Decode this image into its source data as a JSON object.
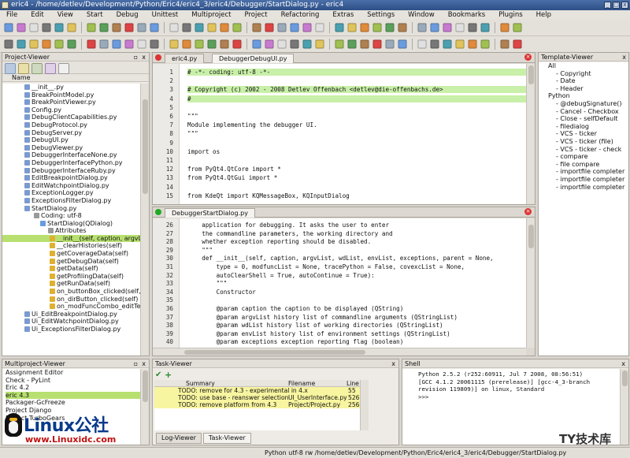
{
  "window": {
    "title": "eric4 - /home/detlev/Development/Python/Eric4/eric4_3/eric4/Debugger/StartDialog.py - eric4"
  },
  "menu": [
    "File",
    "Edit",
    "View",
    "Start",
    "Debug",
    "Unittest",
    "Multiproject",
    "Project",
    "Refactoring",
    "Extras",
    "Settings",
    "Window",
    "Bookmarks",
    "Plugins",
    "Help"
  ],
  "project_viewer": {
    "title": "Project-Viewer",
    "header": "Name",
    "items": [
      "__init__.py",
      "BreakPointModel.py",
      "BreakPointViewer.py",
      "Config.py",
      "DebugClientCapabilities.py",
      "DebugProtocol.py",
      "DebugServer.py",
      "DebugUI.py",
      "DebugViewer.py",
      "DebuggerInterfaceNone.py",
      "DebuggerInterfacePython.py",
      "DebuggerInterfaceRuby.py",
      "EditBreakpointDialog.py",
      "EditWatchpointDialog.py",
      "ExceptionLogger.py",
      "ExceptionsFilterDialog.py",
      "StartDialog.py",
      "Coding: utf-8",
      "StartDialog(QDialog)",
      "Attributes",
      "__init__(self, caption, argvList",
      "__clearHistories(self)",
      "getCoverageData(self)",
      "getDebugData(self)",
      "getData(self)",
      "getProfilingData(self)",
      "getRunData(self)",
      "on_buttonBox_clicked(self, b",
      "on_dirButton_clicked(self)",
      "on_modFuncCombo_editTextC",
      "Ui_EditBreakpointDialog.py",
      "Ui_EditWatchpointDialog.py",
      "Ui_ExceptionsFilterDialog.py"
    ]
  },
  "editor_top": {
    "tab_inactive": "eric4.py",
    "tab_active": "DebuggerDebugUI.py",
    "lines": [
      {
        "n": "1",
        "code": "# -*- coding: utf-8 -*-",
        "hl": true
      },
      {
        "n": "2",
        "code": "",
        "hl": true
      },
      {
        "n": "3",
        "code": "# Copyright (c) 2002 - 2008 Detlev Offenbach <detlev@die-offenbachs.de>",
        "hl": true
      },
      {
        "n": "4",
        "code": "#",
        "hl": true
      },
      {
        "n": "5",
        "code": "",
        "hl": false
      },
      {
        "n": "6",
        "code": "\"\"\"",
        "hl": false
      },
      {
        "n": "7",
        "code": "Module implementing the debugger UI.",
        "hl": false
      },
      {
        "n": "8",
        "code": "\"\"\"",
        "hl": false
      },
      {
        "n": "9",
        "code": "",
        "hl": false
      },
      {
        "n": "10",
        "code": "import os",
        "hl": false
      },
      {
        "n": "11",
        "code": "",
        "hl": false
      },
      {
        "n": "12",
        "code": "from PyQt4.QtCore import *",
        "hl": false
      },
      {
        "n": "13",
        "code": "from PyQt4.QtGui import *",
        "hl": false
      },
      {
        "n": "14",
        "code": "",
        "hl": false
      },
      {
        "n": "15",
        "code": "from KdeQt import KQMessageBox, KQInputDialog",
        "hl": false
      }
    ]
  },
  "editor_bottom": {
    "tab_active": "DebuggerStartDialog.py",
    "lines": [
      {
        "n": "26",
        "code": "    application for debugging. It asks the user to enter"
      },
      {
        "n": "27",
        "code": "    the commandline parameters, the working directory and"
      },
      {
        "n": "28",
        "code": "    whether exception reporting should be disabled."
      },
      {
        "n": "29",
        "code": "    \"\"\""
      },
      {
        "n": "30",
        "code": "    def __init__(self, caption, argvList, wdList, envList, exceptions, parent = None,"
      },
      {
        "n": "31",
        "code": "        type = 0, modfuncList = None, tracePython = False, covexcList = None,"
      },
      {
        "n": "32",
        "code": "        autoClearShell = True, autoContinue = True):"
      },
      {
        "n": "33",
        "code": "        \"\"\""
      },
      {
        "n": "34",
        "code": "        Constructor"
      },
      {
        "n": "35",
        "code": ""
      },
      {
        "n": "36",
        "code": "        @param caption the caption to be displayed (QString)"
      },
      {
        "n": "37",
        "code": "        @param argvList history list of commandline arguments (QStringList)"
      },
      {
        "n": "38",
        "code": "        @param wdList history list of working directories (QStringList)"
      },
      {
        "n": "39",
        "code": "        @param envList history list of environment settings (QStringList)"
      },
      {
        "n": "40",
        "code": "        @param exceptions exception reporting flag (boolean)"
      }
    ]
  },
  "template_viewer": {
    "title": "Template-Viewer",
    "items": [
      "All",
      "- Copyright",
      "- Date",
      "- Header",
      "Python",
      "- @debugSignature()",
      "- Cancel - Checkbox",
      "- Close - selfDefault",
      "- filedialog",
      "- VCS - ticker",
      "- VCS - ticker (file)",
      "- VCS - ticker - check",
      "- compare",
      "- file compare",
      "- importfile completer",
      "- importfile completer",
      "- importfile completer"
    ]
  },
  "multiproject_viewer": {
    "title": "Multiproject-Viewer",
    "items": [
      "Assignment Editor",
      "Check - PyLint",
      "Eric 4.2",
      "eric 4.3",
      "Packager-GcFreeze",
      "Project Django",
      "Project TurboGears"
    ]
  },
  "task_viewer": {
    "title": "Task-Viewer",
    "columns": [
      "Summary",
      "Filename",
      "Line"
    ],
    "rows": [
      {
        "summary": "TODO: remove for 4.3 - experimental in 4.x",
        "file": "",
        "line": "55"
      },
      {
        "summary": "TODO: use base - reanswer selection",
        "file": "UI_UserInterface.py",
        "line": "526"
      },
      {
        "summary": "TODO: remove platform from 4.3",
        "file": "Project/Project.py",
        "line": "256"
      }
    ],
    "tabs": [
      "Log-Viewer",
      "Task-Viewer"
    ]
  },
  "shell": {
    "title": "Shell",
    "lines": [
      "Python 2.5.2 (r252:60911, Jul 7 2008, 08:56:51)",
      "[GCC 4.1.2 20061115 (prerelease)] [gcc-4_3-branch",
      "revision 119809)] on linux, Standard",
      ">>>"
    ]
  },
  "statusbar": {
    "text": "Python  utf-8  rw  /home/detlev/Development/Python/Eric4/eric4_3/eric4/Debugger/StartDialog.py"
  },
  "watermark": {
    "left": "Linux公社",
    "url": "www.Linuxidc.com",
    "right": "TY技术库"
  }
}
